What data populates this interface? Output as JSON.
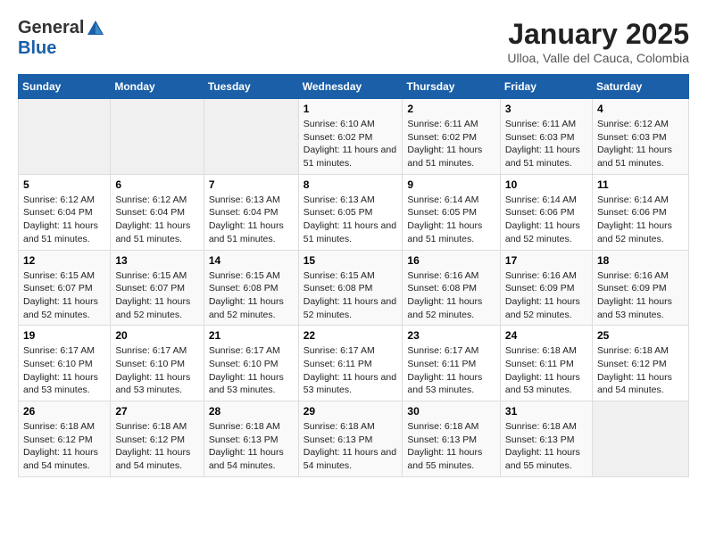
{
  "header": {
    "logo_line1": "General",
    "logo_line2": "Blue",
    "title": "January 2025",
    "subtitle": "Ulloa, Valle del Cauca, Colombia"
  },
  "days_of_week": [
    "Sunday",
    "Monday",
    "Tuesday",
    "Wednesday",
    "Thursday",
    "Friday",
    "Saturday"
  ],
  "weeks": [
    [
      {
        "day": "",
        "info": ""
      },
      {
        "day": "",
        "info": ""
      },
      {
        "day": "",
        "info": ""
      },
      {
        "day": "1",
        "info": "Sunrise: 6:10 AM\nSunset: 6:02 PM\nDaylight: 11 hours and 51 minutes."
      },
      {
        "day": "2",
        "info": "Sunrise: 6:11 AM\nSunset: 6:02 PM\nDaylight: 11 hours and 51 minutes."
      },
      {
        "day": "3",
        "info": "Sunrise: 6:11 AM\nSunset: 6:03 PM\nDaylight: 11 hours and 51 minutes."
      },
      {
        "day": "4",
        "info": "Sunrise: 6:12 AM\nSunset: 6:03 PM\nDaylight: 11 hours and 51 minutes."
      }
    ],
    [
      {
        "day": "5",
        "info": "Sunrise: 6:12 AM\nSunset: 6:04 PM\nDaylight: 11 hours and 51 minutes."
      },
      {
        "day": "6",
        "info": "Sunrise: 6:12 AM\nSunset: 6:04 PM\nDaylight: 11 hours and 51 minutes."
      },
      {
        "day": "7",
        "info": "Sunrise: 6:13 AM\nSunset: 6:04 PM\nDaylight: 11 hours and 51 minutes."
      },
      {
        "day": "8",
        "info": "Sunrise: 6:13 AM\nSunset: 6:05 PM\nDaylight: 11 hours and 51 minutes."
      },
      {
        "day": "9",
        "info": "Sunrise: 6:14 AM\nSunset: 6:05 PM\nDaylight: 11 hours and 51 minutes."
      },
      {
        "day": "10",
        "info": "Sunrise: 6:14 AM\nSunset: 6:06 PM\nDaylight: 11 hours and 52 minutes."
      },
      {
        "day": "11",
        "info": "Sunrise: 6:14 AM\nSunset: 6:06 PM\nDaylight: 11 hours and 52 minutes."
      }
    ],
    [
      {
        "day": "12",
        "info": "Sunrise: 6:15 AM\nSunset: 6:07 PM\nDaylight: 11 hours and 52 minutes."
      },
      {
        "day": "13",
        "info": "Sunrise: 6:15 AM\nSunset: 6:07 PM\nDaylight: 11 hours and 52 minutes."
      },
      {
        "day": "14",
        "info": "Sunrise: 6:15 AM\nSunset: 6:08 PM\nDaylight: 11 hours and 52 minutes."
      },
      {
        "day": "15",
        "info": "Sunrise: 6:15 AM\nSunset: 6:08 PM\nDaylight: 11 hours and 52 minutes."
      },
      {
        "day": "16",
        "info": "Sunrise: 6:16 AM\nSunset: 6:08 PM\nDaylight: 11 hours and 52 minutes."
      },
      {
        "day": "17",
        "info": "Sunrise: 6:16 AM\nSunset: 6:09 PM\nDaylight: 11 hours and 52 minutes."
      },
      {
        "day": "18",
        "info": "Sunrise: 6:16 AM\nSunset: 6:09 PM\nDaylight: 11 hours and 53 minutes."
      }
    ],
    [
      {
        "day": "19",
        "info": "Sunrise: 6:17 AM\nSunset: 6:10 PM\nDaylight: 11 hours and 53 minutes."
      },
      {
        "day": "20",
        "info": "Sunrise: 6:17 AM\nSunset: 6:10 PM\nDaylight: 11 hours and 53 minutes."
      },
      {
        "day": "21",
        "info": "Sunrise: 6:17 AM\nSunset: 6:10 PM\nDaylight: 11 hours and 53 minutes."
      },
      {
        "day": "22",
        "info": "Sunrise: 6:17 AM\nSunset: 6:11 PM\nDaylight: 11 hours and 53 minutes."
      },
      {
        "day": "23",
        "info": "Sunrise: 6:17 AM\nSunset: 6:11 PM\nDaylight: 11 hours and 53 minutes."
      },
      {
        "day": "24",
        "info": "Sunrise: 6:18 AM\nSunset: 6:11 PM\nDaylight: 11 hours and 53 minutes."
      },
      {
        "day": "25",
        "info": "Sunrise: 6:18 AM\nSunset: 6:12 PM\nDaylight: 11 hours and 54 minutes."
      }
    ],
    [
      {
        "day": "26",
        "info": "Sunrise: 6:18 AM\nSunset: 6:12 PM\nDaylight: 11 hours and 54 minutes."
      },
      {
        "day": "27",
        "info": "Sunrise: 6:18 AM\nSunset: 6:12 PM\nDaylight: 11 hours and 54 minutes."
      },
      {
        "day": "28",
        "info": "Sunrise: 6:18 AM\nSunset: 6:13 PM\nDaylight: 11 hours and 54 minutes."
      },
      {
        "day": "29",
        "info": "Sunrise: 6:18 AM\nSunset: 6:13 PM\nDaylight: 11 hours and 54 minutes."
      },
      {
        "day": "30",
        "info": "Sunrise: 6:18 AM\nSunset: 6:13 PM\nDaylight: 11 hours and 55 minutes."
      },
      {
        "day": "31",
        "info": "Sunrise: 6:18 AM\nSunset: 6:13 PM\nDaylight: 11 hours and 55 minutes."
      },
      {
        "day": "",
        "info": ""
      }
    ]
  ]
}
